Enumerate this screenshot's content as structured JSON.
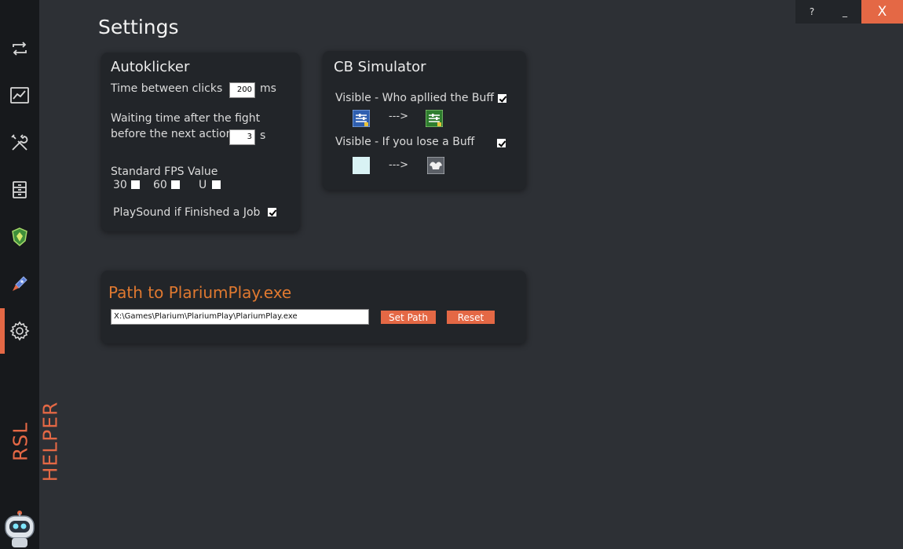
{
  "app": {
    "brand": "RSL HELPER"
  },
  "window_controls": {
    "help": "?",
    "minimize": "_",
    "close": "X"
  },
  "page": {
    "title": "Settings"
  },
  "autoclicker": {
    "title": "Autoklicker",
    "time_between_label": "Time between clicks",
    "time_between_value": "200",
    "time_between_unit": "ms",
    "wait_label_1": "Waiting time after the fight",
    "wait_label_2": "before the next action",
    "wait_value": "3",
    "wait_unit": "s",
    "fps_label": "Standard FPS Value",
    "fps_options": [
      "30",
      "60",
      "U"
    ],
    "playsound_label": "PlaySound if Finished a Job",
    "playsound_checked": true
  },
  "cb_simulator": {
    "title": "CB Simulator",
    "visible_applied_label": "Visible - Who apllied the Buff",
    "visible_applied_checked": true,
    "visible_lose_label": "Visible - If you lose a Buff",
    "visible_lose_checked": true,
    "arrow_1": "--->",
    "arrow_2": "--->"
  },
  "path": {
    "title": "Path to PlariumPlay.exe",
    "value": "X:\\Games\\Plarium\\PlariumPlay\\PlariumPlay.exe",
    "set_path_label": "Set Path",
    "reset_label": "Reset"
  },
  "colors": {
    "accent": "#e46845",
    "path_title": "#e07930",
    "background": "#2d3035",
    "sidebar": "#17191c",
    "panel": "#222529"
  },
  "nav_icons": [
    "swap-arrows-icon",
    "chart-icon",
    "tools-icon",
    "archive-icon",
    "shield-icon",
    "rocket-icon",
    "gear-icon"
  ]
}
